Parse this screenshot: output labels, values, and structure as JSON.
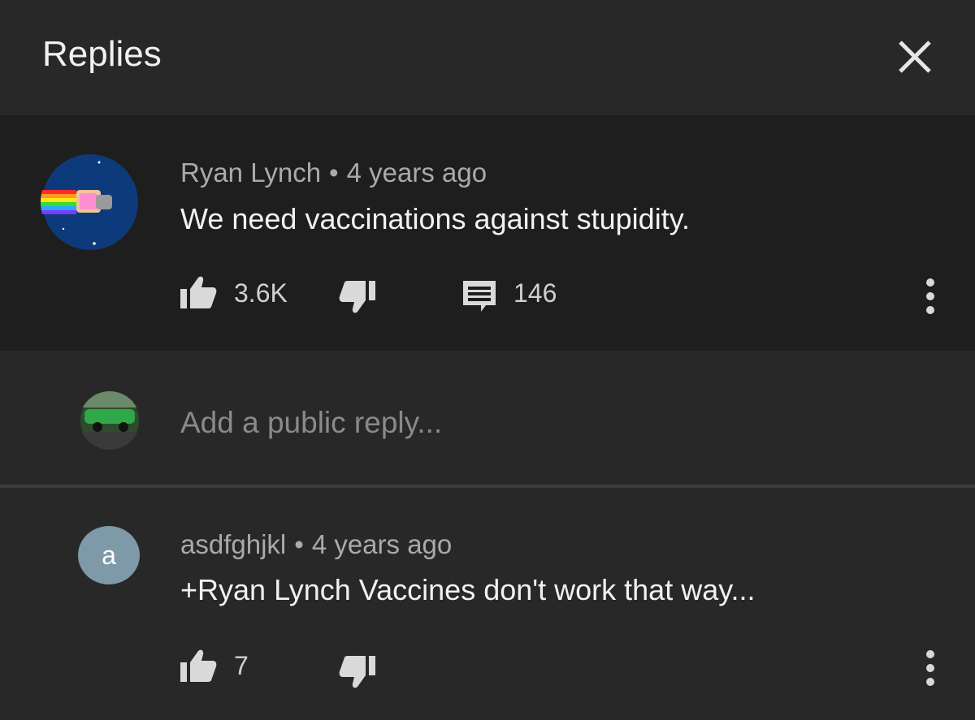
{
  "header": {
    "title": "Replies",
    "close_icon": "close-icon"
  },
  "parent_comment": {
    "author": "Ryan Lynch",
    "separator": "•",
    "time": "4 years ago",
    "text": "We need vaccinations against stupidity.",
    "likes": "3.6K",
    "replies_count": "146",
    "icons": [
      "thumb-up-icon",
      "thumb-down-icon",
      "comment-icon",
      "more-vert-icon"
    ]
  },
  "reply_box": {
    "placeholder": "Add a public reply..."
  },
  "replies": [
    {
      "avatar_letter": "a",
      "author": "asdfghjkl",
      "separator": "•",
      "time": "4 years ago",
      "text": "+Ryan Lynch Vaccines don't work that way...",
      "likes": "7"
    }
  ],
  "colors": {
    "background": "#282828",
    "highlight": "#1e1e1e",
    "text_primary": "#f1f1f1",
    "text_secondary": "#aaaaaa",
    "letter_avatar": "#7e9aa8"
  }
}
